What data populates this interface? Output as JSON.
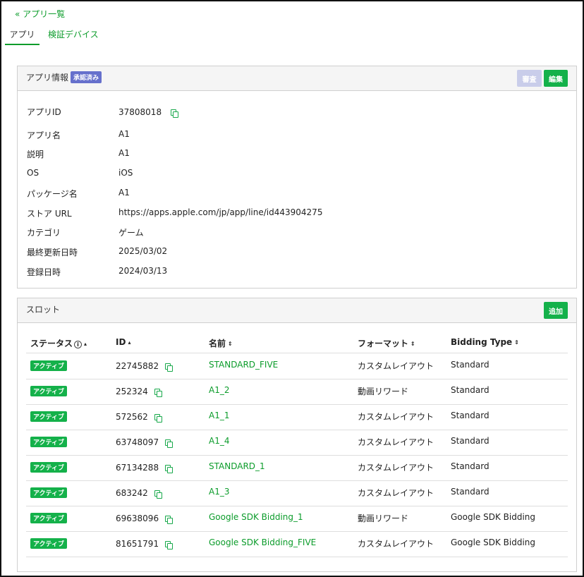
{
  "nav": {
    "back_link": "« アプリ一覧"
  },
  "tabs": [
    {
      "label": "アプリ",
      "active": true
    },
    {
      "label": "検証デバイス",
      "active": false
    }
  ],
  "app_info": {
    "title": "アプリ情報",
    "status_badge": "承認済み",
    "review_label": "審査",
    "edit_label": "編集",
    "rows": [
      {
        "label": "アプリID",
        "value": "37808018",
        "copyable": true
      },
      {
        "label": "アプリ名",
        "value": "A1"
      },
      {
        "label": "説明",
        "value": "A1"
      },
      {
        "label": "OS",
        "value": "iOS"
      },
      {
        "label": "パッケージ名",
        "value": "A1"
      },
      {
        "label": "ストア URL",
        "value": "https://apps.apple.com/jp/app/line/id443904275"
      },
      {
        "label": "カテゴリ",
        "value": "ゲーム"
      },
      {
        "label": "最終更新日時",
        "value": "2025/03/02"
      },
      {
        "label": "登録日時",
        "value": "2024/03/13"
      }
    ]
  },
  "slots": {
    "title": "スロット",
    "add_label": "追加",
    "headers": {
      "status": "ステータス",
      "info_glyph": "i",
      "id": "ID",
      "name": "名前",
      "format": "フォーマット",
      "bidding": "Bidding Type"
    },
    "sort_asc": "▴",
    "sort_both": "⇕",
    "rows": [
      {
        "status": "アクティブ",
        "id": "22745882",
        "name": "STANDARD_FIVE",
        "format": "カスタムレイアウト",
        "bidding": "Standard"
      },
      {
        "status": "アクティブ",
        "id": "252324",
        "name": "A1_2",
        "format": "動画リワード",
        "bidding": "Standard"
      },
      {
        "status": "アクティブ",
        "id": "572562",
        "name": "A1_1",
        "format": "カスタムレイアウト",
        "bidding": "Standard"
      },
      {
        "status": "アクティブ",
        "id": "63748097",
        "name": "A1_4",
        "format": "カスタムレイアウト",
        "bidding": "Standard"
      },
      {
        "status": "アクティブ",
        "id": "67134288",
        "name": "STANDARD_1",
        "format": "カスタムレイアウト",
        "bidding": "Standard"
      },
      {
        "status": "アクティブ",
        "id": "683242",
        "name": "A1_3",
        "format": "カスタムレイアウト",
        "bidding": "Standard"
      },
      {
        "status": "アクティブ",
        "id": "69638096",
        "name": "Google SDK Bidding_1",
        "format": "動画リワード",
        "bidding": "Google SDK Bidding"
      },
      {
        "status": "アクティブ",
        "id": "81651791",
        "name": "Google SDK Bidding_FIVE",
        "format": "カスタムレイアウト",
        "bidding": "Google SDK Bidding"
      }
    ]
  }
}
